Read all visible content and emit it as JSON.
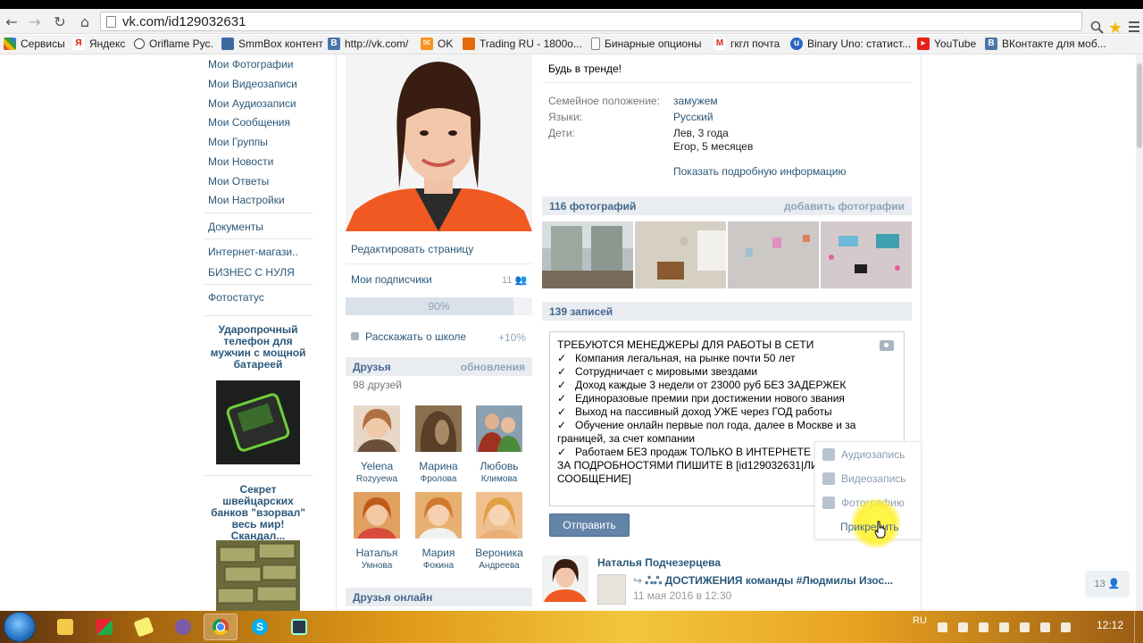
{
  "browser": {
    "url": "vk.com/id129032631",
    "bookmarks": [
      {
        "label": "Сервисы",
        "icon": "apps-icon",
        "color": "#e5502f"
      },
      {
        "label": "Яндекс",
        "icon": "yandex-icon",
        "color": "#e61400"
      },
      {
        "label": "Oriflame Рус.",
        "icon": "oriflame-icon",
        "color": "#444444"
      },
      {
        "label": "SmmBox контент",
        "icon": "smmbox-icon",
        "color": "#3b6aa0"
      },
      {
        "label": "http://vk.com/",
        "icon": "vk-icon",
        "color": "#4a76a8"
      },
      {
        "label": "OK",
        "icon": "ok-icon",
        "color": "#f7931e"
      },
      {
        "label": "Trading RU - 1800о...",
        "icon": "trading-icon",
        "color": "#e36c09"
      },
      {
        "label": "Бинарные опционы",
        "icon": "doc-icon",
        "color": "#666666"
      },
      {
        "label": "гкгл почта",
        "icon": "gmail-icon",
        "color": "#d93025"
      },
      {
        "label": "Binary Uno: статист...",
        "icon": "binary-uno-icon",
        "color": "#2b64c5"
      },
      {
        "label": "YouTube",
        "icon": "youtube-icon",
        "color": "#e62117"
      },
      {
        "label": "ВКонтакте для моб...",
        "icon": "vk-icon",
        "color": "#4a76a8"
      }
    ]
  },
  "left_menu": {
    "items": [
      "Мои Фотографии",
      "Мои Видеозаписи",
      "Мои Аудиозаписи",
      "Мои Сообщения",
      "Мои Группы",
      "Мои Новости",
      "Мои Ответы",
      "Мои Настройки"
    ],
    "items2": [
      "Документы"
    ],
    "items3": [
      "Интернет-магази..",
      "БИЗНЕС С НУЛЯ"
    ],
    "items4": [
      "Фотостатус"
    ],
    "ad1_title": "Ударопрочный телефон для мужчин с мощной батареей",
    "ad2_title": "Секрет швейцарских банков \"взорвал\" весь мир! Скандал..."
  },
  "profile": {
    "edit_page": "Редактировать страницу",
    "subscribers_label": "Мои подписчики",
    "subscribers_count": "11",
    "progress_text": "90%",
    "progress_value": 0.9,
    "school_label": "Расскажать о школе",
    "school_bonus": "+10%",
    "friends_title": "Друзья",
    "friends_updates": "обновления",
    "friends_count": "98 друзей",
    "friends": [
      {
        "first": "Yelena",
        "last": "Rozyyewa"
      },
      {
        "first": "Марина",
        "last": "Фролова"
      },
      {
        "first": "Любовь",
        "last": "Климова"
      },
      {
        "first": "Наталья",
        "last": "Умнова"
      },
      {
        "first": "Мария",
        "last": "Фокина"
      },
      {
        "first": "Вероника",
        "last": "Андреева"
      }
    ],
    "friends_online_title": "Друзья онлайн"
  },
  "info": {
    "status": "Будь в тренде!",
    "rows": [
      {
        "label": "Семейное положение:",
        "value": "замужем"
      },
      {
        "label": "Языки:",
        "value": "Русский"
      },
      {
        "label": "Дети:",
        "value": "Лев, 3 года"
      }
    ],
    "children_extra": "Егор, 5 месяцев",
    "more_info": "Показать подробную информацию"
  },
  "photos": {
    "title": "116 фотографий",
    "add": "добавить фотографии"
  },
  "wall": {
    "title": "139 записей",
    "composer_text": "ТРЕБУЮТСЯ МЕНЕДЖЕРЫ ДЛЯ РАБОТЫ В СЕТИ\n✓   Компания легальная, на рынке почти 50 лет\n✓   Сотрудничает с мировыми звездами\n✓   Доход каждые 3 недели от 23000 руб БЕЗ ЗАДЕРЖЕК\n✓   Единоразовые премии при достижении нового звания\n✓   Выход на пассивный доход УЖЕ через ГОД работы\n✓   Обучение онлайн первые пол года, далее в Москве и за границей, за счет компании\n✓   Работаем БЕЗ продаж ТОЛЬКО В ИНТЕРНЕТЕ\nЗА ПОДРОБНОСТЯМИ ПИШИТЕ В [id129032631|ЛИЧНОЕ СООБЩЕНИЕ]",
    "send": "Отправить",
    "attach_menu": [
      "Аудиозапись",
      "Видеозапись",
      "Фотографию"
    ],
    "attach": "Прикрепить",
    "post_author": "Наталья Подчезерцева",
    "post_text": "ДОСТИЖЕНИЯ команды #Людмилы Изос...",
    "post_date": "11 мая 2016 в 12:30"
  },
  "online_count": "13",
  "taskbar": {
    "lang": "RU",
    "clock": "12:12"
  }
}
